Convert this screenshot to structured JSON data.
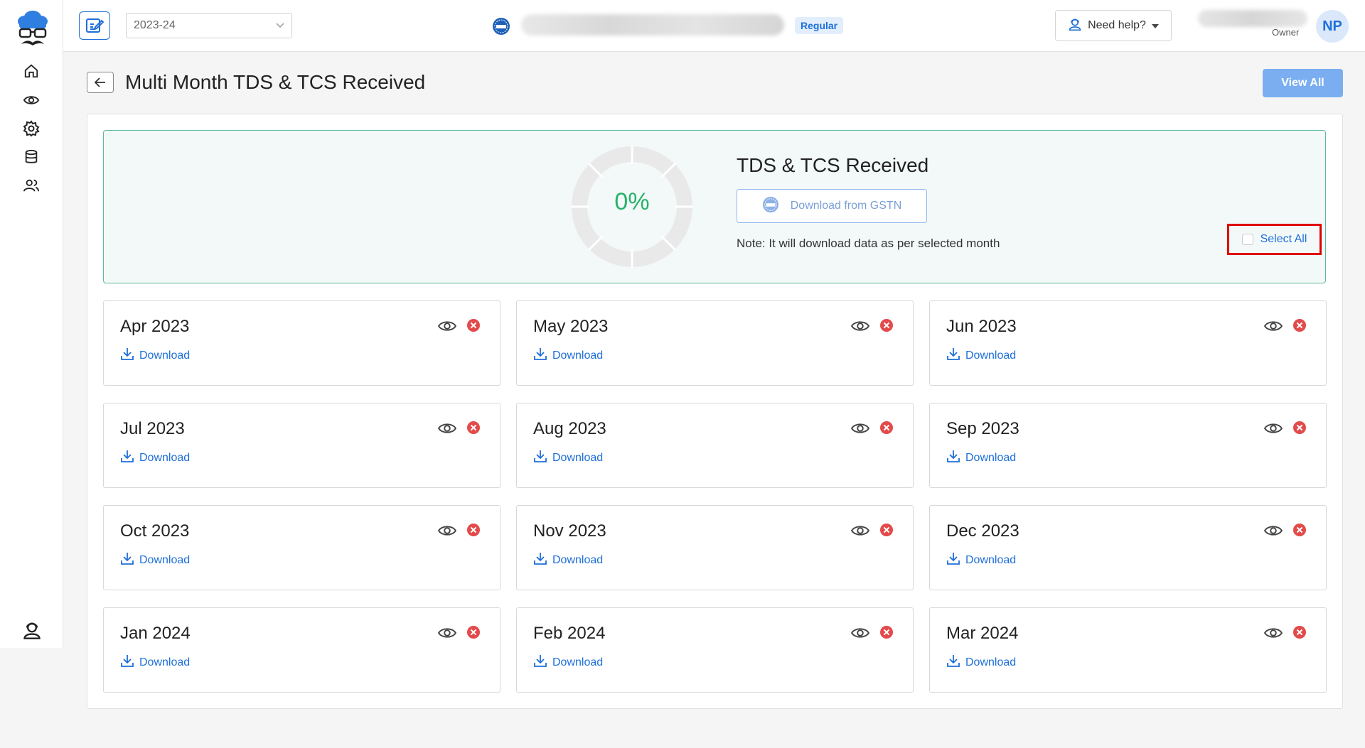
{
  "topbar": {
    "year": "2023-24",
    "registration_type": "Regular",
    "help_label": "Need help?",
    "role": "Owner",
    "avatar_initials": "NP"
  },
  "page": {
    "title": "Multi Month TDS & TCS Received",
    "view_all_label": "View All"
  },
  "summary": {
    "progress_text": "0%",
    "progress_value": 0,
    "title": "TDS & TCS Received",
    "download_button": "Download from GSTN",
    "note": "Note: It will download data as per selected month",
    "select_all_label": "Select All"
  },
  "download_label": "Download",
  "months": [
    {
      "name": "Apr 2023"
    },
    {
      "name": "May 2023"
    },
    {
      "name": "Jun 2023"
    },
    {
      "name": "Jul 2023"
    },
    {
      "name": "Aug 2023"
    },
    {
      "name": "Sep 2023"
    },
    {
      "name": "Oct 2023"
    },
    {
      "name": "Nov 2023"
    },
    {
      "name": "Dec 2023"
    },
    {
      "name": "Jan 2024"
    },
    {
      "name": "Feb 2024"
    },
    {
      "name": "Mar 2024"
    }
  ],
  "colors": {
    "accent": "#1e6fd9",
    "success": "#27b26b",
    "danger": "#e34a4a",
    "highlight_border": "#e00000"
  },
  "icons": {
    "sidebar": [
      "home-icon",
      "eye-icon",
      "gear-icon",
      "database-icon",
      "users-icon"
    ],
    "card_actions": [
      "eye-icon",
      "close-icon",
      "download-icon"
    ]
  }
}
